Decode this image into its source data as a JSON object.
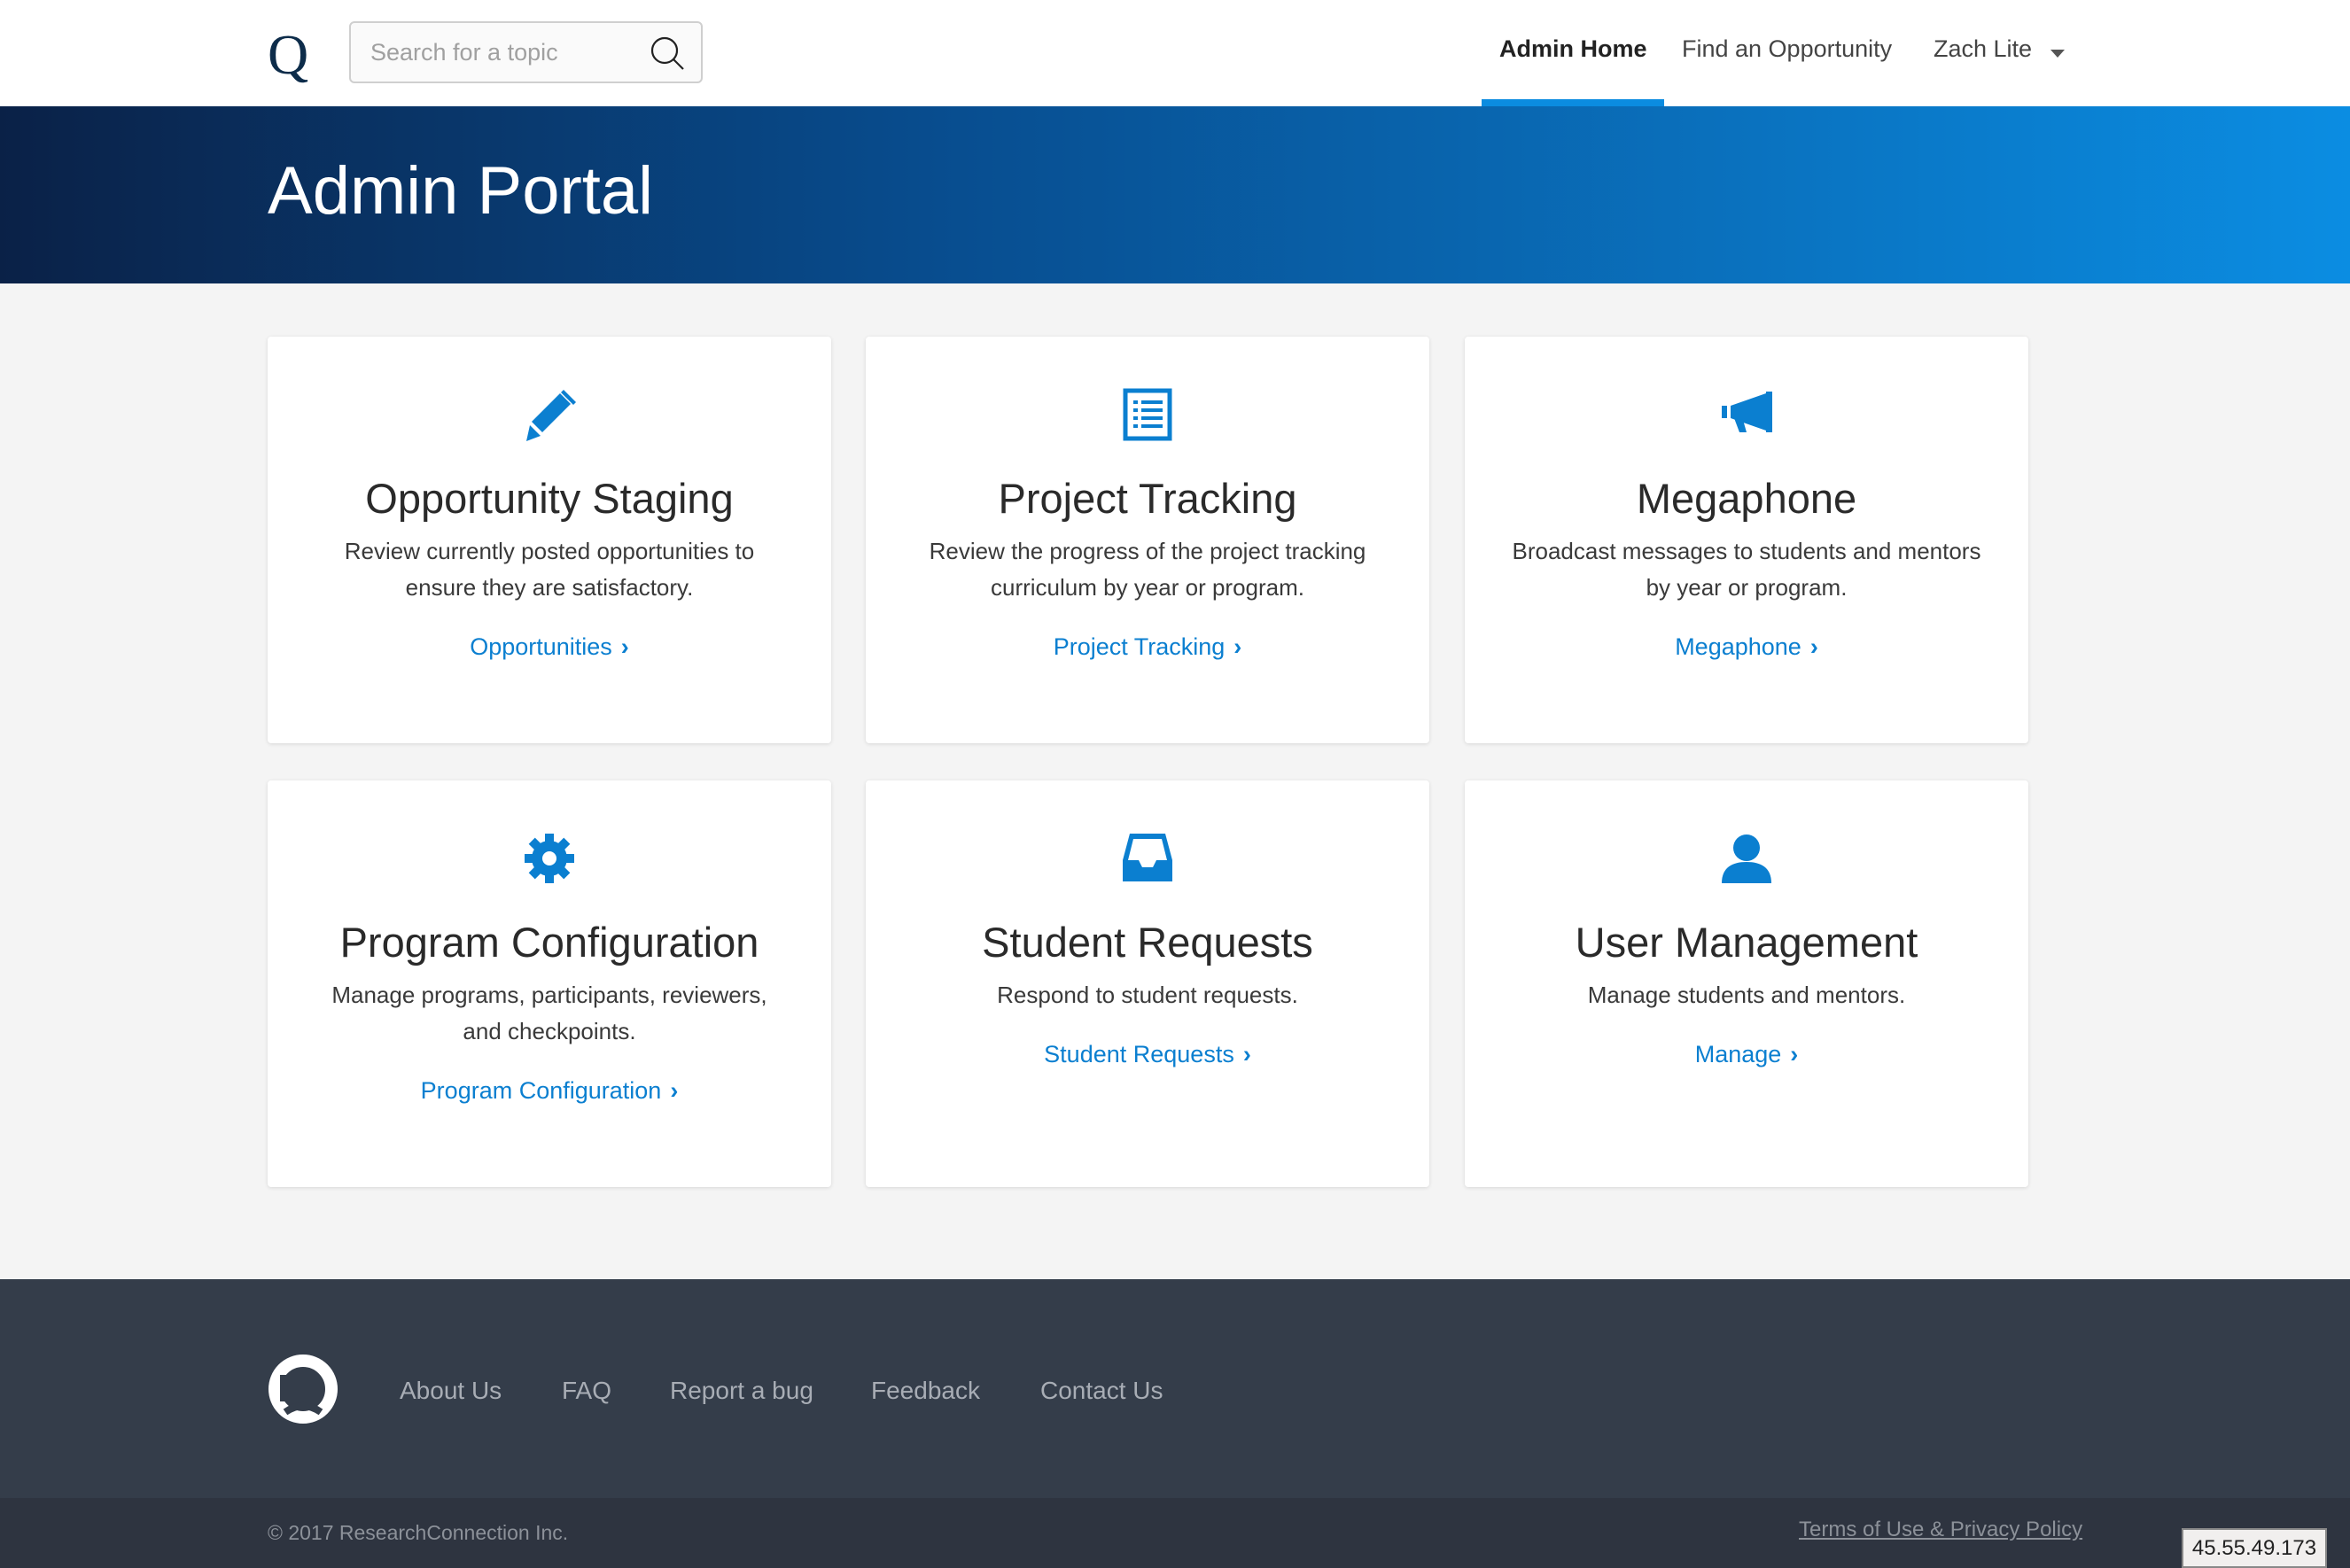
{
  "header": {
    "logo": "Q",
    "search_placeholder": "Search for a topic",
    "nav": [
      {
        "label": "Admin Home",
        "active": true
      },
      {
        "label": "Find an Opportunity"
      },
      {
        "label": "Zach Lite"
      }
    ]
  },
  "banner": {
    "title": "Admin Portal"
  },
  "cards": [
    {
      "icon": "pencil-icon",
      "title": "Opportunity Staging",
      "description": "Review currently posted opportunities to ensure they are satisfactory.",
      "link": "Opportunities"
    },
    {
      "icon": "list-icon",
      "title": "Project Tracking",
      "description": "Review the progress of the project tracking curriculum by year or program.",
      "link": "Project Tracking"
    },
    {
      "icon": "megaphone-icon",
      "title": "Megaphone",
      "description": "Broadcast messages to students and mentors by year or program.",
      "link": "Megaphone"
    },
    {
      "icon": "gear-icon",
      "title": "Program Configuration",
      "description": "Manage programs, participants, reviewers, and checkpoints.",
      "link": "Program Configuration"
    },
    {
      "icon": "inbox-icon",
      "title": "Student Requests",
      "description": "Respond to student requests.",
      "link": "Student Requests"
    },
    {
      "icon": "user-icon",
      "title": "User Management",
      "description": "Manage students and mentors.",
      "link": "Manage"
    }
  ],
  "footer": {
    "links": [
      "About Us",
      "FAQ",
      "Report a bug",
      "Feedback",
      "Contact Us"
    ],
    "copyright": "© 2017 ResearchConnection Inc.",
    "terms": "Terms of Use & Privacy Policy"
  },
  "ip_badge": "45.55.49.173",
  "colors": {
    "accent": "#0b8ce0",
    "link": "#0b7fd0",
    "footer": "#343d4a"
  }
}
